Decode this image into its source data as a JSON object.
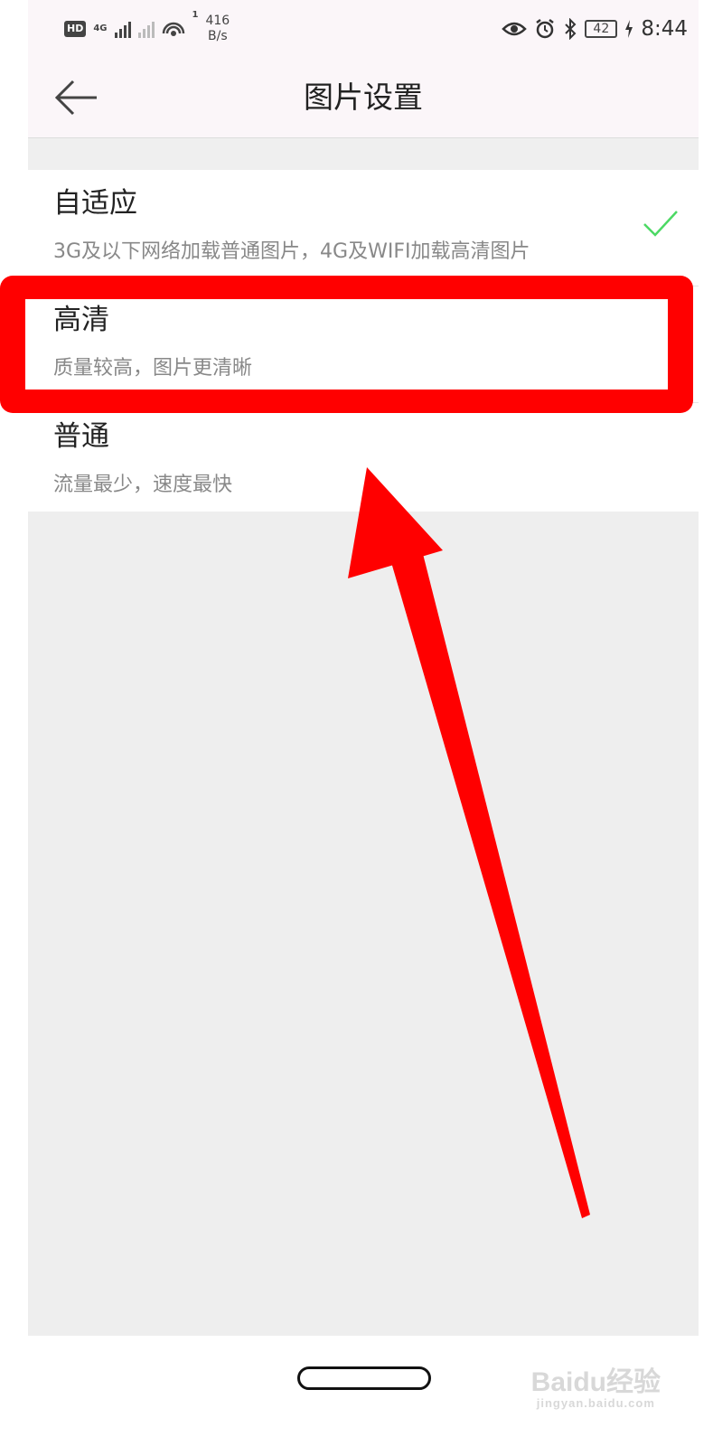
{
  "status_bar": {
    "hd_label": "HD",
    "sim_label": "4G",
    "hotspot_count": "1",
    "net_speed_value": "416",
    "net_speed_unit": "B/s",
    "battery_level": "42",
    "time": "8:44"
  },
  "header": {
    "title": "图片设置"
  },
  "options": [
    {
      "title": "自适应",
      "description": "3G及以下网络加载普通图片，4G及WIFI加载高清图片",
      "selected": true
    },
    {
      "title": "高清",
      "description": "质量较高，图片更清晰",
      "selected": false
    },
    {
      "title": "普通",
      "description": "流量最少，速度最快",
      "selected": false
    }
  ],
  "annotation": {
    "highlight_color": "#ff0000",
    "highlighted_option": "高清"
  },
  "watermark": {
    "main": "Baidu经验",
    "sub": "jingyan.baidu.com"
  },
  "colors": {
    "checkmark": "#4cd964",
    "background": "#eeeeee",
    "header_background": "#fbf6f9"
  }
}
